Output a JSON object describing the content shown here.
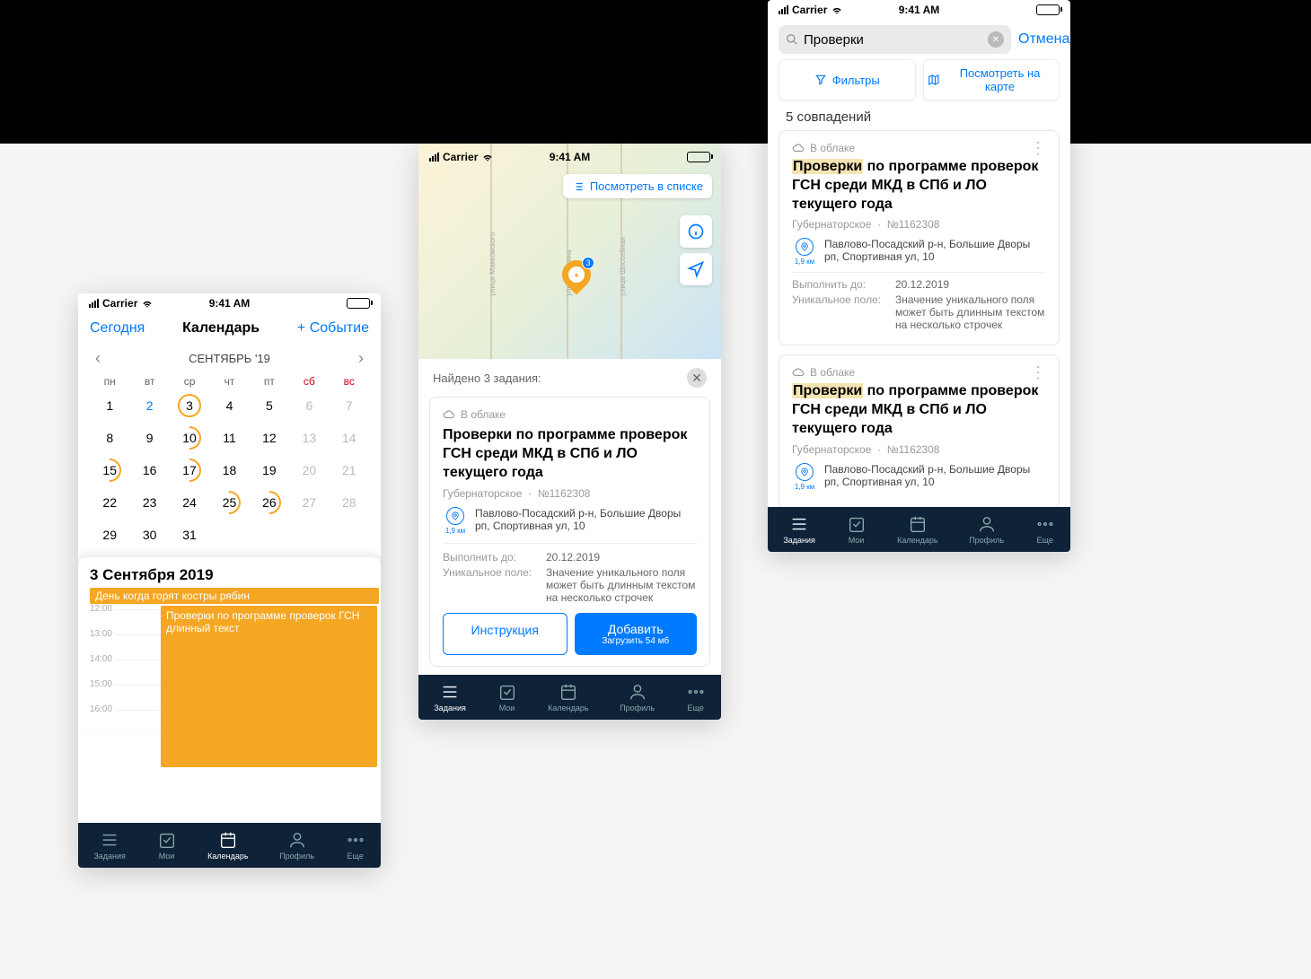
{
  "statusbar": {
    "carrier": "Carrier",
    "time": "9:41 AM"
  },
  "tabs": {
    "tasks": "Задания",
    "my": "Мои",
    "calendar": "Календарь",
    "profile": "Профиль",
    "more": "Еще"
  },
  "s1": {
    "today": "Сегодня",
    "title": "Календарь",
    "addevent": "+ Событие",
    "month": "СЕНТЯБРЬ '19",
    "weekdays": [
      "пн",
      "вт",
      "ср",
      "чт",
      "пт",
      "сб",
      "вс"
    ],
    "rows": [
      [
        {
          "d": "1"
        },
        {
          "d": "2",
          "blue": true
        },
        {
          "d": "3",
          "ring": true
        },
        {
          "d": "4"
        },
        {
          "d": "5"
        },
        {
          "d": "6",
          "mute": true
        },
        {
          "d": "7",
          "mute": true
        }
      ],
      [
        {
          "d": "8"
        },
        {
          "d": "9"
        },
        {
          "d": "10",
          "partial": true
        },
        {
          "d": "11"
        },
        {
          "d": "12"
        },
        {
          "d": "13",
          "mute": true
        },
        {
          "d": "14",
          "mute": true
        }
      ],
      [
        {
          "d": "15",
          "partial": true
        },
        {
          "d": "16"
        },
        {
          "d": "17",
          "partial": true
        },
        {
          "d": "18"
        },
        {
          "d": "19"
        },
        {
          "d": "20",
          "mute": true
        },
        {
          "d": "21",
          "mute": true
        }
      ],
      [
        {
          "d": "22"
        },
        {
          "d": "23"
        },
        {
          "d": "24"
        },
        {
          "d": "25",
          "partial": true
        },
        {
          "d": "26",
          "partial": true
        },
        {
          "d": "27",
          "mute": true
        },
        {
          "d": "28",
          "mute": true
        }
      ],
      [
        {
          "d": "29"
        },
        {
          "d": "30"
        },
        {
          "d": "31"
        },
        {
          "d": ""
        },
        {
          "d": ""
        },
        {
          "d": ""
        },
        {
          "d": ""
        }
      ]
    ],
    "dayheader": "3 Сентября 2019",
    "allday": "День когда горят костры рябин",
    "event": "Проверки по программе проверок ГСН длинный текст",
    "hours": [
      "12:00",
      "13:00",
      "14:00",
      "15:00",
      "16:00"
    ]
  },
  "s2": {
    "listbtn": "Посмотреть в списке",
    "found": "Найдено 3 задания:",
    "pin_badge": "3",
    "streets": [
      "улица Маяковского",
      "улица Ленина",
      "улица Шоссейная"
    ],
    "card": {
      "status": "В облаке",
      "title": "Проверки по программе проверок ГСН среди МКД в СПб и ЛО текущего года",
      "org": "Губернаторское",
      "num": "№1162308",
      "distance": "1,9 км",
      "address": "Павлово-Посадский р-н, Большие Дворы рп, Спортивная ул, 10",
      "due_k": "Выполнить до:",
      "due_v": "20.12.2019",
      "uk": "Уникальное поле:",
      "uv": "Значение уникального поля может быть длинным текстом на несколько строчек",
      "instr": "Инструкция",
      "add": "Добавить",
      "addsub": "Загрузить 54 мб"
    }
  },
  "s3": {
    "query": "Проверки",
    "cancel": "Отмена",
    "filters": "Фильтры",
    "viewmap": "Посмотреть на карте",
    "matches": "5 совпадений",
    "card": {
      "status": "В облаке",
      "hl": "Проверки",
      "rest": " по программе проверок ГСН среди МКД в СПб и ЛО текущего года",
      "org": "Губернаторское",
      "num": "№1162308",
      "distance": "1,9 км",
      "address": "Павлово-Посадский р-н, Большие Дворы рп, Спортивная ул, 10",
      "due_k": "Выполнить до:",
      "due_v": "20.12.2019",
      "uk": "Уникальное поле:",
      "uv": "Значение уникального поля может быть длинным текстом на несколько строчек"
    }
  }
}
